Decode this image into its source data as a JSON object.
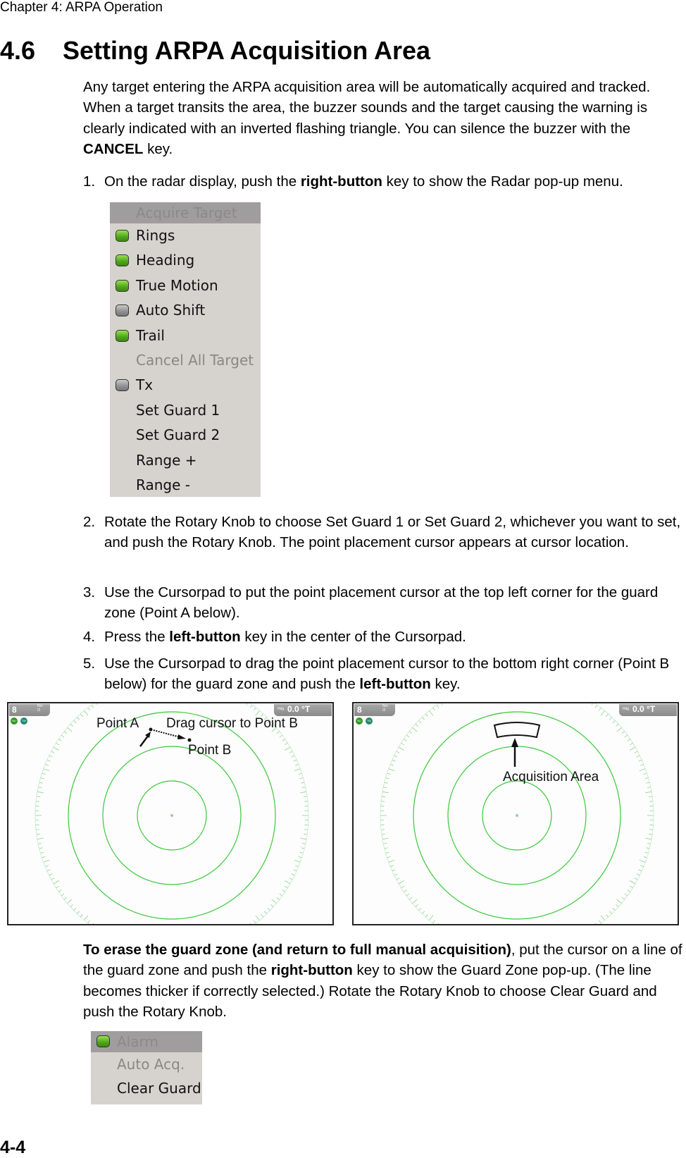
{
  "header": {
    "chapter": "Chapter 4: ARPA Operation"
  },
  "section": {
    "number": "4.6",
    "title": "Setting ARPA Acquisition Area"
  },
  "intro": {
    "text_1": "Any target entering the ARPA acquisition area will be automatically acquired and tracked. When a target transits the area, the buzzer sounds and the target causing the warning is clearly indicated with an inverted flashing triangle. You can silence the buzzer with the ",
    "bold_1": "CANCEL",
    "text_2": " key."
  },
  "steps": [
    {
      "num": "1.",
      "pre": "On the radar display, push the ",
      "bold": "right-button",
      "post": " key to show the Radar pop-up menu."
    },
    {
      "num": "2.",
      "pre": "Rotate the Rotary Knob to choose Set Guard 1 or Set Guard 2, whichever you want to set, and push the Rotary Knob. The point placement cursor appears at cursor location.",
      "bold": "",
      "post": ""
    },
    {
      "num": "3.",
      "pre": "Use the Cursorpad to put the point placement cursor at the top left corner for the guard zone (Point A below).",
      "bold": "",
      "post": ""
    },
    {
      "num": "4.",
      "pre": "Press the ",
      "bold": "left-button",
      "post": " key in the center of the Cursorpad."
    },
    {
      "num": "5.",
      "pre": "Use the Cursorpad to drag the point placement cursor to the bottom right corner (Point B below) for the guard zone and push the ",
      "bold": "left-button",
      "post": " key."
    }
  ],
  "radar_menu": {
    "header": "Acquire Target",
    "items": [
      {
        "label": "Rings",
        "indicator": "on",
        "disabled": false
      },
      {
        "label": "Heading",
        "indicator": "on",
        "disabled": false
      },
      {
        "label": "True Motion",
        "indicator": "on",
        "disabled": false
      },
      {
        "label": "Auto Shift",
        "indicator": "off",
        "disabled": false
      },
      {
        "label": "Trail",
        "indicator": "on",
        "disabled": false
      },
      {
        "label": "Cancel All Target",
        "indicator": "none",
        "disabled": true
      },
      {
        "label": "Tx",
        "indicator": "off",
        "disabled": false
      },
      {
        "label": "Set Guard 1",
        "indicator": "none",
        "disabled": false
      },
      {
        "label": "Set Guard 2",
        "indicator": "none",
        "disabled": false
      },
      {
        "label": "Range +",
        "indicator": "none",
        "disabled": false
      },
      {
        "label": "Range -",
        "indicator": "none",
        "disabled": false
      }
    ]
  },
  "radar_panels": [
    {
      "range_value": "8",
      "range_unit": "Nm",
      "range_ring_interval": "/2",
      "heading_label": "Hdg",
      "heading_value": "0.0 °T",
      "mode_buttons": [
        "NU",
        "TM"
      ],
      "annotations": {
        "point_a": "Point A",
        "drag": "Drag cursor to Point B",
        "point_b": "Point B"
      }
    },
    {
      "range_value": "8",
      "range_unit": "Nm",
      "range_ring_interval": "/2",
      "heading_label": "Hdg",
      "heading_value": "0.0 °T",
      "mode_buttons": [
        "NU",
        "TM"
      ],
      "annotations": {
        "acquisition_area": "Acquisition Area"
      }
    }
  ],
  "erase": {
    "bold": "To erase the guard zone (and return to full manual acquisition)",
    "text_1": ", put the cursor on a line of the guard zone and push the ",
    "bold_2": "right-button",
    "text_2": " key to show the Guard Zone pop-up. (The line becomes thicker if correctly selected.) Rotate the Rotary Knob to choose Clear Guard and push the Rotary Knob."
  },
  "guard_menu": {
    "header": "Alarm",
    "header_indicator": "on",
    "items": [
      {
        "label": "Auto Acq.",
        "disabled": true
      },
      {
        "label": "Clear Guard",
        "disabled": false
      }
    ]
  },
  "colors": {
    "ring_green": "#3cc83c",
    "menu_bg": "#d6d2ce",
    "menu_header": "#a09d9f",
    "indicator_on": "#5fb82a",
    "indicator_off": "#8f8f93"
  },
  "footer": {
    "page": "4-4"
  }
}
